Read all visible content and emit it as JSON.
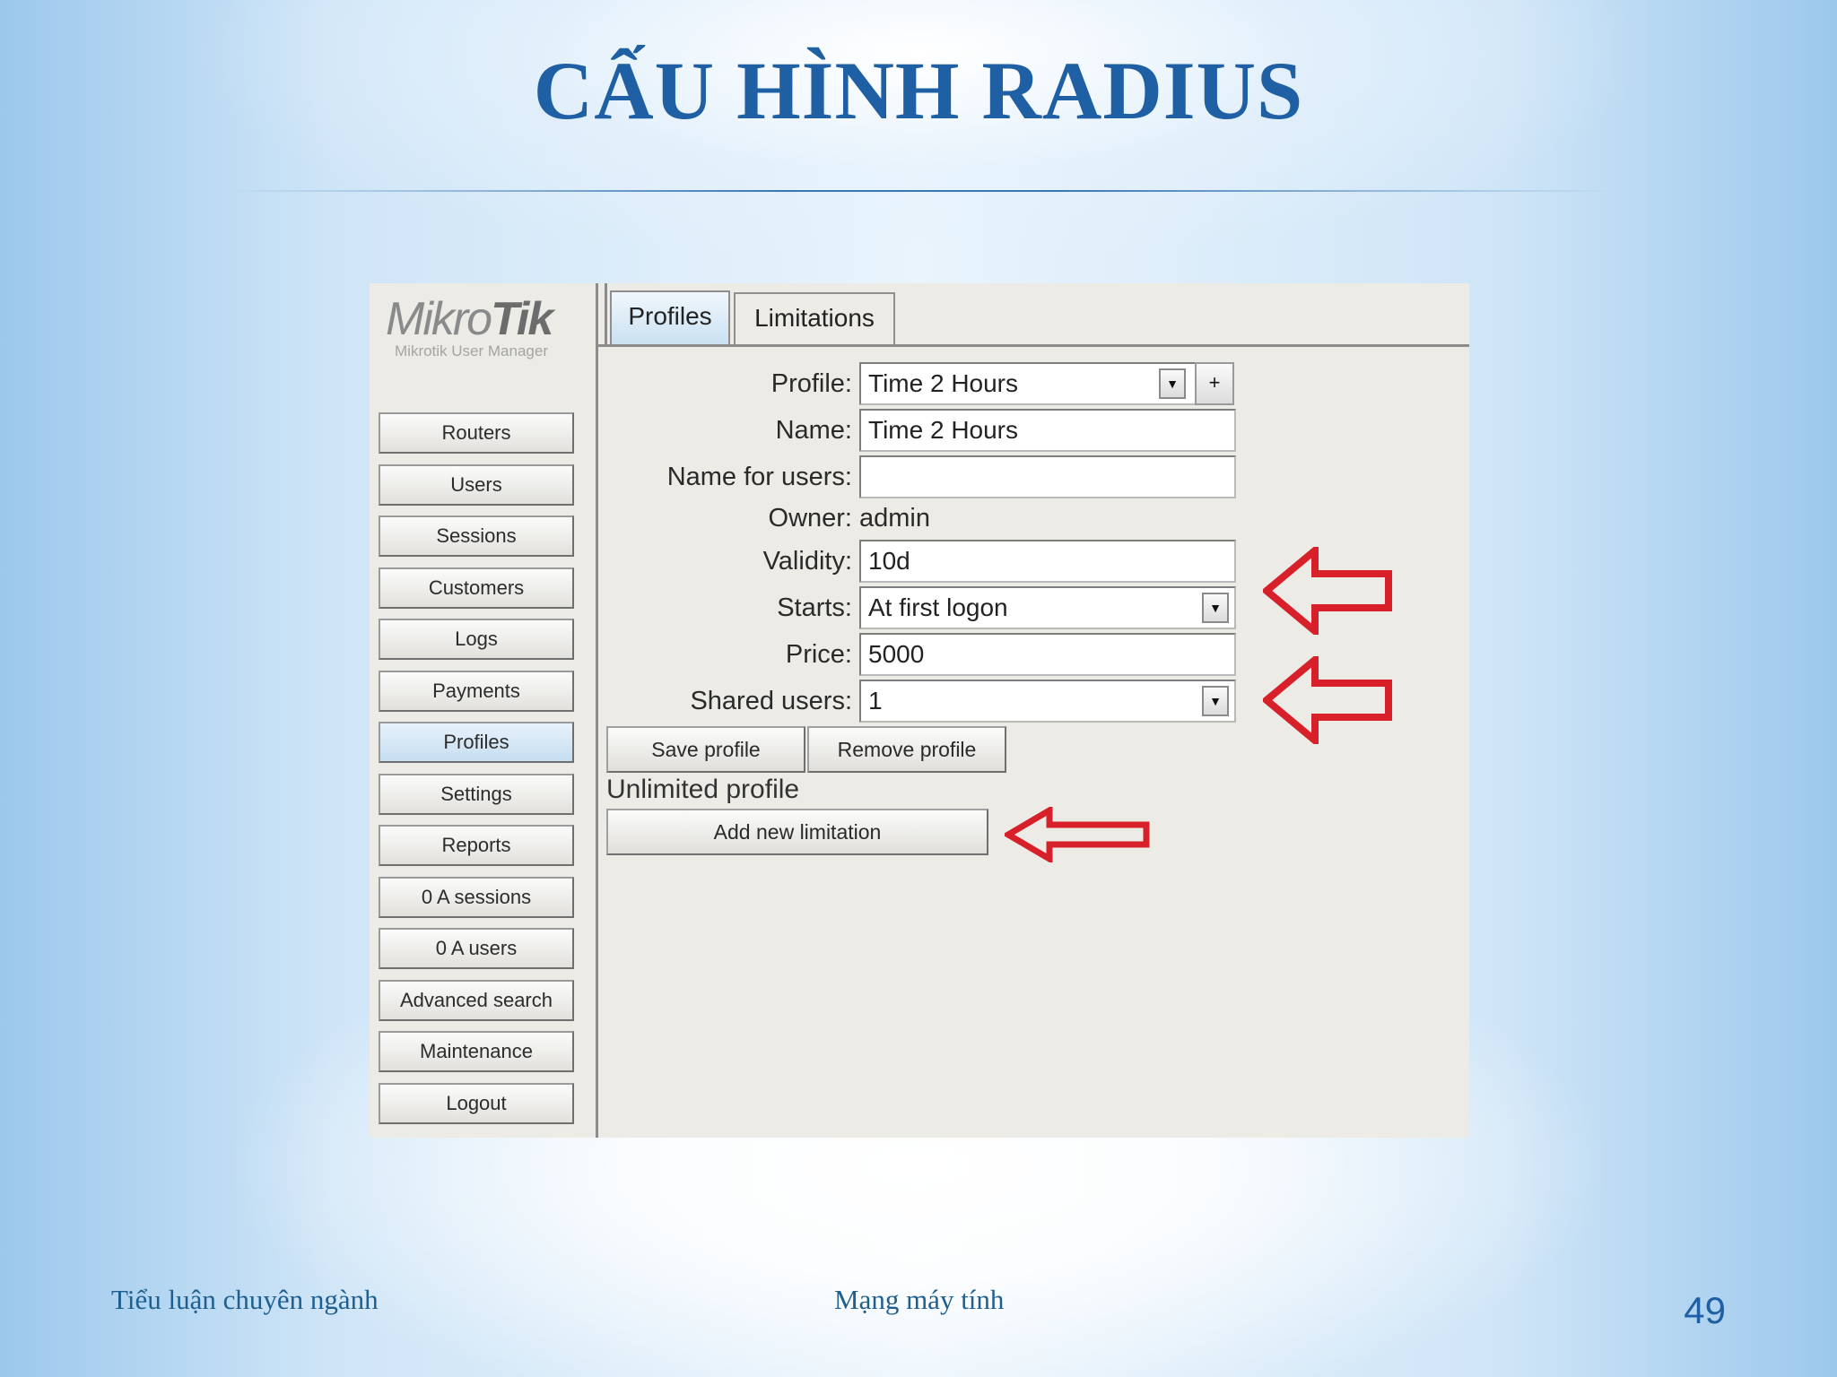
{
  "slide": {
    "title": "CẤU HÌNH RADIUS",
    "footer_left": "Tiểu luận chuyên ngành",
    "footer_center": "Mạng máy tính",
    "page_number": "49"
  },
  "app": {
    "logo_main": "MikroTik",
    "logo_sub": "Mikrotik User Manager",
    "sidebar_items": [
      {
        "label": "Routers"
      },
      {
        "label": "Users"
      },
      {
        "label": "Sessions"
      },
      {
        "label": "Customers"
      },
      {
        "label": "Logs"
      },
      {
        "label": "Payments"
      },
      {
        "label": "Profiles",
        "active": true
      },
      {
        "label": "Settings"
      },
      {
        "label": "Reports"
      },
      {
        "label": "0 A sessions"
      },
      {
        "label": "0 A users"
      },
      {
        "label": "Advanced search"
      },
      {
        "label": "Maintenance"
      },
      {
        "label": "Logout"
      }
    ],
    "tabs": [
      {
        "label": "Profiles",
        "active": true
      },
      {
        "label": "Limitations"
      }
    ],
    "form": {
      "profile_label": "Profile:",
      "profile_value": "Time 2 Hours",
      "name_label": "Name:",
      "name_value": "Time 2 Hours",
      "name_for_users_label": "Name for users:",
      "name_for_users_value": "",
      "owner_label": "Owner:",
      "owner_value": "admin",
      "validity_label": "Validity:",
      "validity_value": "10d",
      "starts_label": "Starts:",
      "starts_value": "At first logon",
      "price_label": "Price:",
      "price_value": "5000",
      "shared_users_label": "Shared users:",
      "shared_users_value": "1",
      "plus_symbol": "+",
      "dropdown_symbol": "▼"
    },
    "buttons": {
      "save_profile": "Save profile",
      "remove_profile": "Remove profile",
      "add_new_limitation": "Add new limitation"
    },
    "section_label": "Unlimited profile"
  },
  "colors": {
    "title": "#1f5fa3",
    "annotation_arrow": "#d8202a",
    "active_tab": "#c9e0f1"
  }
}
